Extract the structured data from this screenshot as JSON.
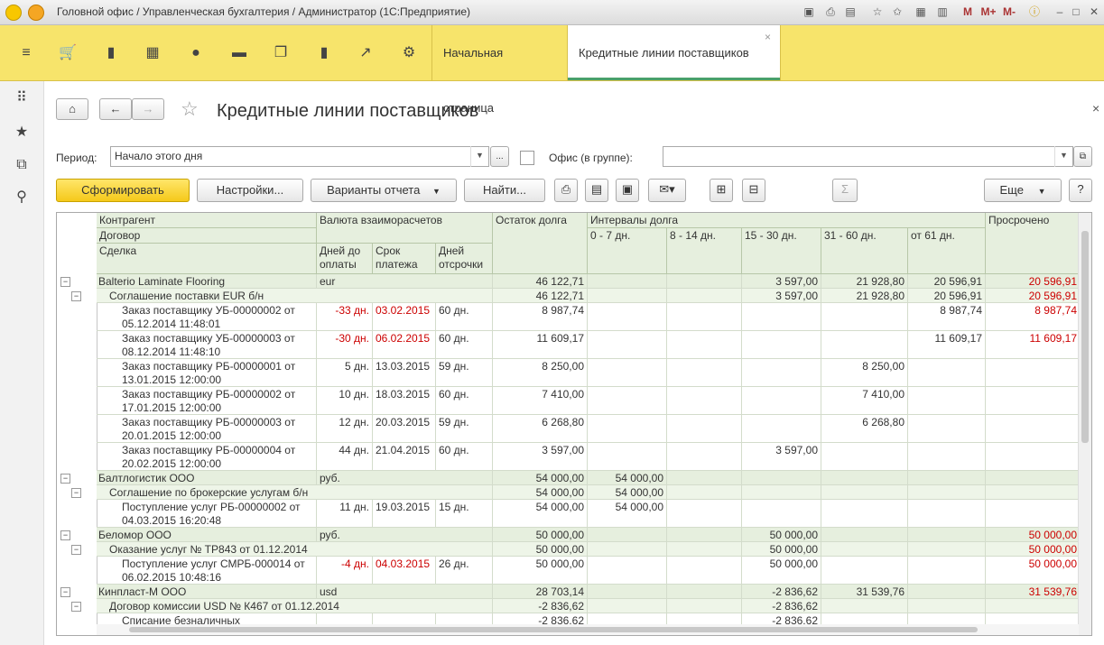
{
  "window": {
    "title": "Головной офис / Управленческая бухгалтерия / Администратор  (1С:Предприятие)",
    "toolbar_m": "M",
    "toolbar_mplus": "M+",
    "toolbar_mminus": "M-"
  },
  "tabs": {
    "home": "Начальная страница",
    "active": "Кредитные линии поставщиков",
    "close": "×"
  },
  "form": {
    "title": "Кредитные линии поставщиков",
    "close": "×",
    "period_label": "Период:",
    "period_value": "Начало этого дня",
    "office_label": "Офис (в группе):",
    "office_value": "",
    "dots": "...",
    "form_button": "Сформировать",
    "settings_button": "Настройки...",
    "variants_button": "Варианты отчета",
    "find_button": "Найти...",
    "more_button": "Еще",
    "help_button": "?",
    "sum_button": "Σ"
  },
  "report": {
    "headers": {
      "contragent": "Контрагент",
      "contract": "Договор",
      "deal": "Сделка",
      "currency": "Валюта взаиморасчетов",
      "days_to_pay": "Дней до оплаты",
      "pay_term": "Срок платежа",
      "delay_days": "Дней отсрочки",
      "balance": "Остаток долга",
      "intervals": "Интервалы долга",
      "i1": "0 - 7 дн.",
      "i2": "8 - 14 дн.",
      "i3": "15 - 30 дн.",
      "i4": "31 - 60 дн.",
      "i5": "от 61 дн.",
      "overdue": "Просрочено"
    },
    "rows": [
      {
        "level": 1,
        "text": "Balterio Laminate Flooring",
        "cur": "eur",
        "days": "",
        "term": "",
        "delay": "",
        "bal": "46 122,71",
        "i1": "",
        "i2": "",
        "i3": "3 597,00",
        "i4": "21 928,80",
        "i5": "20 596,91",
        "over": "20 596,91"
      },
      {
        "level": 2,
        "text": "Соглашение поставки EUR б/н",
        "cur": "",
        "days": "",
        "term": "",
        "delay": "",
        "bal": "46 122,71",
        "i1": "",
        "i2": "",
        "i3": "3 597,00",
        "i4": "21 928,80",
        "i5": "20 596,91",
        "over": "20 596,91"
      },
      {
        "level": 3,
        "text": "Заказ поставщику УБ-00000002 от",
        "text2": "05.12.2014 11:48:01",
        "cur": "",
        "days": "-33 дн.",
        "term": "03.02.2015",
        "delay": "60 дн.",
        "bal": "8 987,74",
        "i1": "",
        "i2": "",
        "i3": "",
        "i4": "",
        "i5": "8 987,74",
        "over": "8 987,74",
        "red": true
      },
      {
        "level": 3,
        "text": "Заказ поставщику УБ-00000003 от",
        "text2": "08.12.2014 11:48:10",
        "cur": "",
        "days": "-30 дн.",
        "term": "06.02.2015",
        "delay": "60 дн.",
        "bal": "11 609,17",
        "i1": "",
        "i2": "",
        "i3": "",
        "i4": "",
        "i5": "11 609,17",
        "over": "11 609,17",
        "red": true
      },
      {
        "level": 3,
        "text": "Заказ поставщику РБ-00000001 от",
        "text2": "13.01.2015 12:00:00",
        "cur": "",
        "days": "5 дн.",
        "term": "13.03.2015",
        "delay": "59 дн.",
        "bal": "8 250,00",
        "i1": "",
        "i2": "",
        "i3": "",
        "i4": "8 250,00",
        "i5": "",
        "over": ""
      },
      {
        "level": 3,
        "text": "Заказ поставщику РБ-00000002 от",
        "text2": "17.01.2015 12:00:00",
        "cur": "",
        "days": "10 дн.",
        "term": "18.03.2015",
        "delay": "60 дн.",
        "bal": "7 410,00",
        "i1": "",
        "i2": "",
        "i3": "",
        "i4": "7 410,00",
        "i5": "",
        "over": ""
      },
      {
        "level": 3,
        "text": "Заказ поставщику РБ-00000003 от",
        "text2": "20.01.2015 12:00:00",
        "cur": "",
        "days": "12 дн.",
        "term": "20.03.2015",
        "delay": "59 дн.",
        "bal": "6 268,80",
        "i1": "",
        "i2": "",
        "i3": "",
        "i4": "6 268,80",
        "i5": "",
        "over": ""
      },
      {
        "level": 3,
        "text": "Заказ поставщику РБ-00000004 от",
        "text2": "20.02.2015 12:00:00",
        "cur": "",
        "days": "44 дн.",
        "term": "21.04.2015",
        "delay": "60 дн.",
        "bal": "3 597,00",
        "i1": "",
        "i2": "",
        "i3": "3 597,00",
        "i4": "",
        "i5": "",
        "over": ""
      },
      {
        "level": 1,
        "text": "Балтлогистик ООО",
        "cur": "руб.",
        "days": "",
        "term": "",
        "delay": "",
        "bal": "54 000,00",
        "i1": "54 000,00",
        "i2": "",
        "i3": "",
        "i4": "",
        "i5": "",
        "over": ""
      },
      {
        "level": 2,
        "text": "Соглашение по брокерские услугам б/н",
        "cur": "",
        "days": "",
        "term": "",
        "delay": "",
        "bal": "54 000,00",
        "i1": "54 000,00",
        "i2": "",
        "i3": "",
        "i4": "",
        "i5": "",
        "over": ""
      },
      {
        "level": 3,
        "text": "Поступление услуг РБ-00000002 от",
        "text2": "04.03.2015 16:20:48",
        "cur": "",
        "days": "11 дн.",
        "term": "19.03.2015",
        "delay": "15 дн.",
        "bal": "54 000,00",
        "i1": "54 000,00",
        "i2": "",
        "i3": "",
        "i4": "",
        "i5": "",
        "over": ""
      },
      {
        "level": 1,
        "text": "Беломор ООО",
        "cur": "руб.",
        "days": "",
        "term": "",
        "delay": "",
        "bal": "50 000,00",
        "i1": "",
        "i2": "",
        "i3": "50 000,00",
        "i4": "",
        "i5": "",
        "over": "50 000,00"
      },
      {
        "level": 2,
        "text": "Оказание услуг № ТР843 от 01.12.2014",
        "cur": "",
        "days": "",
        "term": "",
        "delay": "",
        "bal": "50 000,00",
        "i1": "",
        "i2": "",
        "i3": "50 000,00",
        "i4": "",
        "i5": "",
        "over": "50 000,00"
      },
      {
        "level": 3,
        "text": "Поступление услуг СМРБ-000014 от",
        "text2": "06.02.2015 10:48:16",
        "cur": "",
        "days": "-4 дн.",
        "term": "04.03.2015",
        "delay": "26 дн.",
        "bal": "50 000,00",
        "i1": "",
        "i2": "",
        "i3": "50 000,00",
        "i4": "",
        "i5": "",
        "over": "50 000,00",
        "red": true
      },
      {
        "level": 1,
        "text": "Кинпласт-М ООО",
        "cur": "usd",
        "days": "",
        "term": "",
        "delay": "",
        "bal": "28 703,14",
        "i1": "",
        "i2": "",
        "i3": "-2 836,62",
        "i4": "31 539,76",
        "i5": "",
        "over": "31 539,76"
      },
      {
        "level": 2,
        "text": "Договор комиссии USD № К467 от 01.12.2014",
        "cur": "",
        "days": "",
        "term": "",
        "delay": "",
        "bal": "-2 836,62",
        "i1": "",
        "i2": "",
        "i3": "-2 836,62",
        "i4": "",
        "i5": "",
        "over": ""
      },
      {
        "level": 3,
        "text": "Списание безналичных",
        "text2": "",
        "cur": "",
        "days": "",
        "term": "",
        "delay": "",
        "bal": "-2 836,62",
        "i1": "",
        "i2": "",
        "i3": "-2 836,62",
        "i4": "",
        "i5": "",
        "over": ""
      }
    ]
  }
}
